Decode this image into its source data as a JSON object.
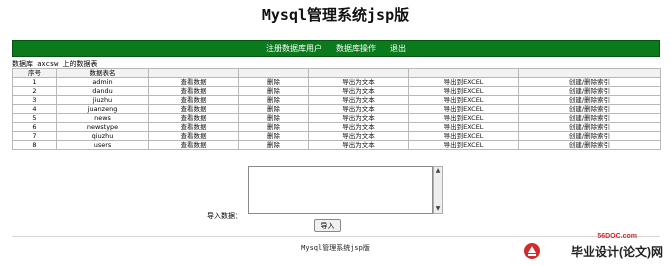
{
  "page": {
    "title": "Mysql管理系统jsp版"
  },
  "nav": {
    "items": [
      "注册数据库用户",
      "数据库操作",
      "退出"
    ]
  },
  "db_caption": "数据库 axcsw 上的数据表",
  "table": {
    "headers": [
      "序号",
      "数据表名",
      "",
      "",
      "",
      "",
      ""
    ],
    "rows": [
      [
        "1",
        "admin",
        "查看数据",
        "删除",
        "导出为文本",
        "导出到EXCEL",
        "创建/删除索引"
      ],
      [
        "2",
        "dandu",
        "查看数据",
        "删除",
        "导出为文本",
        "导出到EXCEL",
        "创建/删除索引"
      ],
      [
        "3",
        "jiuzhu",
        "查看数据",
        "删除",
        "导出为文本",
        "导出到EXCEL",
        "创建/删除索引"
      ],
      [
        "4",
        "juanzeng",
        "查看数据",
        "删除",
        "导出为文本",
        "导出到EXCEL",
        "创建/删除索引"
      ],
      [
        "5",
        "news",
        "查看数据",
        "删除",
        "导出为文本",
        "导出到EXCEL",
        "创建/删除索引"
      ],
      [
        "6",
        "newstype",
        "查看数据",
        "删除",
        "导出为文本",
        "导出到EXCEL",
        "创建/删除索引"
      ],
      [
        "7",
        "qiuzhu",
        "查看数据",
        "删除",
        "导出为文本",
        "导出到EXCEL",
        "创建/删除索引"
      ],
      [
        "8",
        "users",
        "查看数据",
        "删除",
        "导出为文本",
        "导出到EXCEL",
        "创建/删除索引"
      ]
    ]
  },
  "import": {
    "label": "导入数据：",
    "value": "",
    "button": "导入"
  },
  "footer": "Mysql管理系统jsp版",
  "brand": {
    "domain": "56DOC.com",
    "name": "毕业设计(论文)网"
  },
  "colors": {
    "nav_bg": "#0a7a1c",
    "nav_text": "#ffffff",
    "brand_red": "#d12b2b"
  }
}
